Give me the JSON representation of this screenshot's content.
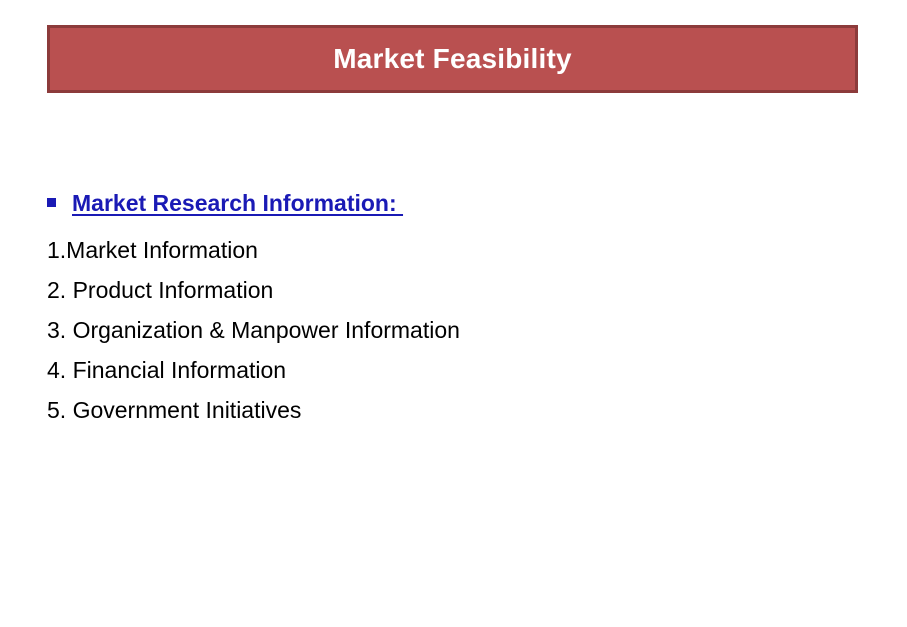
{
  "slide": {
    "title": "Market Feasibility",
    "title_banner": {
      "fill_color": "#b95050",
      "border_color": "#8c3b3b",
      "text_color": "#ffffff"
    },
    "background_color": "#ffffff"
  },
  "content": {
    "heading": {
      "bullet_glyph": "square-bullet",
      "text": "Market Research Information: ",
      "color": "#1a1ab5",
      "underlined": true,
      "bold": true
    },
    "list": {
      "items": [
        {
          "label": "1.Market Information"
        },
        {
          "label": "2. Product Information"
        },
        {
          "label": "3. Organization & Manpower Information"
        },
        {
          "label": "4. Financial Information"
        },
        {
          "label": "5. Government Initiatives"
        }
      ]
    },
    "text_color": "#000000"
  }
}
